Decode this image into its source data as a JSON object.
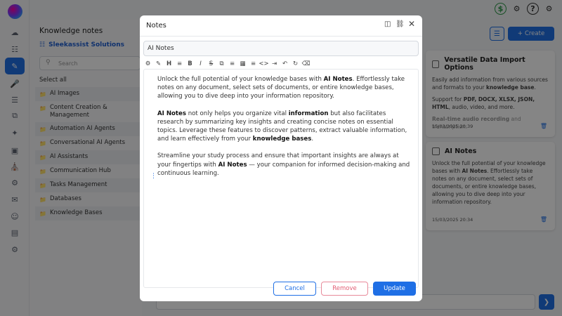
{
  "app": {
    "topbar": {
      "icons": [
        "dollar-icon",
        "robot-icon",
        "help-icon",
        "settings-icon"
      ]
    },
    "rail": {
      "icons": [
        "home-icon",
        "database-icon",
        "notes-icon",
        "mic-icon",
        "checklist-icon",
        "copy-icon",
        "sparkle-icon",
        "image-icon",
        "bank-icon",
        "robot-icon",
        "chat-icon",
        "users-icon",
        "server-icon",
        "gear-icon"
      ],
      "active": "notes-icon"
    },
    "knowledge": {
      "title": "Knowledge notes",
      "org": "Sleekassist Solutions",
      "search_placeholder": "Search",
      "select_all": "Select all",
      "folders": [
        "AI Images",
        "Content Creation & Management",
        "Automation AI Agents",
        "Conversational AI Agents",
        "AI Assistants",
        "Communication Hub",
        "Tasks Management",
        "Databases",
        "Knowledge Bases"
      ]
    },
    "header": {
      "create_label": "Create"
    },
    "cards": [
      {
        "title": "Versatile Data Import Options",
        "date": "15/03/2025 20:39"
      },
      {
        "title": "AI Notes",
        "date": "15/03/2025 20:34"
      }
    ]
  },
  "modal": {
    "title": "Notes",
    "note_title_value": "AI Notes",
    "toolbar_icons": [
      "robot-icon",
      "pen-icon",
      "heading-icon",
      "align-icon",
      "bold-icon",
      "italic-icon",
      "strikethrough-icon",
      "copy-icon",
      "bullet-list-icon",
      "table-icon",
      "numbered-list-icon",
      "code-icon",
      "indent-icon",
      "undo-icon",
      "redo-icon",
      "clear-format-icon"
    ],
    "buttons": {
      "cancel": "Cancel",
      "remove": "Remove",
      "update": "Update"
    }
  },
  "colors": {
    "accent": "#1f6fe5",
    "danger": "#e25c73"
  }
}
